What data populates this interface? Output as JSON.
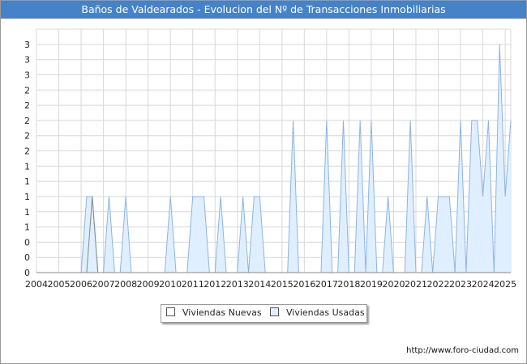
{
  "title": "Baños de Valdearados - Evolucion del Nº de Transacciones Inmobiliarias",
  "source": "http://www.foro-ciudad.com",
  "colors": {
    "title_bg": "#4682c8",
    "grid": "#d8d8d8",
    "nuevas_line": "#888888",
    "nuevas_fill": "#ffffff",
    "usadas_line": "#8cb4e6",
    "usadas_fill": "#e0efff"
  },
  "chart_data": {
    "type": "area",
    "title": "Baños de Valdearados - Evolucion del Nº de Transacciones Inmobiliarias",
    "xlabel": "",
    "ylabel": "",
    "x_ticks": [
      "2004",
      "2005",
      "2006",
      "2007",
      "2008",
      "2009",
      "2010",
      "2011",
      "2012",
      "2013",
      "2014",
      "2015",
      "2016",
      "2017",
      "2018",
      "2019",
      "2020",
      "2021",
      "2022",
      "2023",
      "2024",
      "2025"
    ],
    "y_ticks": [
      "0",
      "0",
      "0",
      "1",
      "1",
      "1",
      "1",
      "1",
      "2",
      "2",
      "2",
      "2",
      "2",
      "3",
      "3",
      "3"
    ],
    "ylim": [
      0,
      3.2
    ],
    "grid": true,
    "legend_position": "bottom",
    "series": [
      {
        "name": "Viviendas Nuevas",
        "points": [
          [
            2006.25,
            0
          ],
          [
            2006.5,
            1
          ],
          [
            2006.75,
            0
          ]
        ]
      },
      {
        "name": "Viviendas Usadas",
        "points": [
          [
            2006.0,
            0
          ],
          [
            2006.25,
            1
          ],
          [
            2006.5,
            1
          ],
          [
            2006.75,
            0
          ],
          [
            2007.0,
            0
          ],
          [
            2007.25,
            1
          ],
          [
            2007.5,
            0
          ],
          [
            2007.75,
            0
          ],
          [
            2008.0,
            1
          ],
          [
            2008.25,
            0
          ],
          [
            2009.75,
            0
          ],
          [
            2010.0,
            1
          ],
          [
            2010.25,
            0
          ],
          [
            2010.75,
            0
          ],
          [
            2011.0,
            1
          ],
          [
            2011.5,
            1
          ],
          [
            2011.75,
            0
          ],
          [
            2012.0,
            0
          ],
          [
            2012.25,
            1
          ],
          [
            2012.5,
            0
          ],
          [
            2013.0,
            0
          ],
          [
            2013.25,
            1
          ],
          [
            2013.5,
            0
          ],
          [
            2013.75,
            1
          ],
          [
            2014.0,
            1
          ],
          [
            2014.25,
            0
          ],
          [
            2015.25,
            0
          ],
          [
            2015.5,
            2
          ],
          [
            2015.75,
            0
          ],
          [
            2016.75,
            0
          ],
          [
            2017.0,
            2
          ],
          [
            2017.25,
            0
          ],
          [
            2017.5,
            0
          ],
          [
            2017.75,
            2
          ],
          [
            2018.0,
            0
          ],
          [
            2018.25,
            0
          ],
          [
            2018.5,
            2
          ],
          [
            2018.75,
            0
          ],
          [
            2019.0,
            2
          ],
          [
            2019.25,
            0
          ],
          [
            2019.5,
            0
          ],
          [
            2019.75,
            1
          ],
          [
            2020.0,
            0
          ],
          [
            2020.5,
            0
          ],
          [
            2020.75,
            2
          ],
          [
            2021.0,
            0
          ],
          [
            2021.25,
            0
          ],
          [
            2021.5,
            1
          ],
          [
            2021.75,
            0
          ],
          [
            2022.0,
            1
          ],
          [
            2022.5,
            1
          ],
          [
            2022.75,
            0
          ],
          [
            2023.0,
            2
          ],
          [
            2023.25,
            0
          ],
          [
            2023.5,
            2
          ],
          [
            2023.75,
            2
          ],
          [
            2024.0,
            1
          ],
          [
            2024.25,
            2
          ],
          [
            2024.5,
            0
          ],
          [
            2024.75,
            3
          ],
          [
            2025.0,
            1
          ],
          [
            2025.25,
            2
          ]
        ]
      }
    ]
  }
}
